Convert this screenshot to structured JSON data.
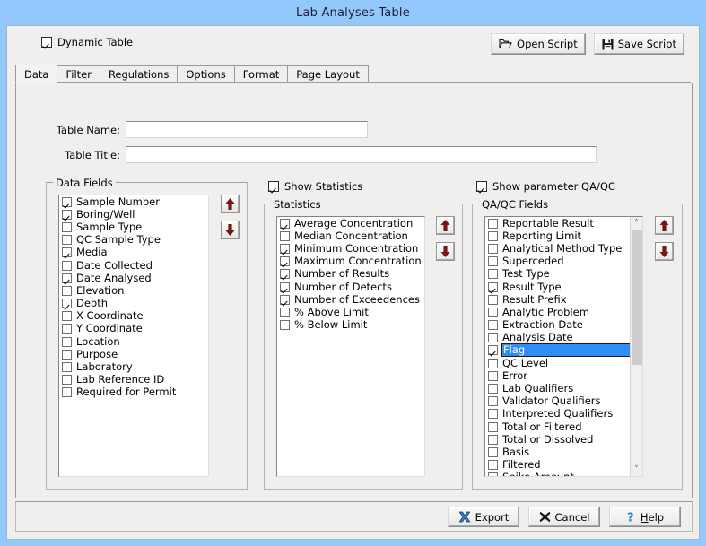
{
  "window": {
    "title": "Lab Analyses Table"
  },
  "toolbar": {
    "dynamic_table_label": "Dynamic Table",
    "dynamic_table_checked": true,
    "open_script_label": "Open Script",
    "save_script_label": "Save Script"
  },
  "tabs": [
    {
      "label": "Data",
      "active": true
    },
    {
      "label": "Filter",
      "active": false
    },
    {
      "label": "Regulations",
      "active": false
    },
    {
      "label": "Options",
      "active": false
    },
    {
      "label": "Format",
      "active": false
    },
    {
      "label": "Page Layout",
      "active": false
    }
  ],
  "form": {
    "table_name_label": "Table Name:",
    "table_name_value": "",
    "table_title_label": "Table Title:",
    "table_title_value": ""
  },
  "data_fields": {
    "group_label": "Data Fields",
    "items": [
      {
        "label": "Sample Number",
        "checked": true
      },
      {
        "label": "Boring/Well",
        "checked": true
      },
      {
        "label": "Sample Type",
        "checked": false
      },
      {
        "label": "QC Sample Type",
        "checked": false
      },
      {
        "label": "Media",
        "checked": true
      },
      {
        "label": "Date Collected",
        "checked": false
      },
      {
        "label": "Date Analysed",
        "checked": true
      },
      {
        "label": "Elevation",
        "checked": false
      },
      {
        "label": "Depth",
        "checked": true
      },
      {
        "label": "X Coordinate",
        "checked": false
      },
      {
        "label": "Y Coordinate",
        "checked": false
      },
      {
        "label": "Location",
        "checked": false
      },
      {
        "label": "Purpose",
        "checked": false
      },
      {
        "label": "Laboratory",
        "checked": false
      },
      {
        "label": "Lab Reference ID",
        "checked": false
      },
      {
        "label": "Required for Permit",
        "checked": false
      }
    ]
  },
  "statistics": {
    "show_label": "Show Statistics",
    "show_checked": true,
    "group_label": "Statistics",
    "items": [
      {
        "label": "Average Concentration",
        "checked": true
      },
      {
        "label": "Median Concentration",
        "checked": false
      },
      {
        "label": "Minimum Concentration",
        "checked": true
      },
      {
        "label": "Maximum Concentration",
        "checked": true
      },
      {
        "label": "Number of Results",
        "checked": true
      },
      {
        "label": "Number of Detects",
        "checked": true
      },
      {
        "label": "Number of Exceedences",
        "checked": true
      },
      {
        "label": "% Above Limit",
        "checked": false
      },
      {
        "label": "% Below Limit",
        "checked": false
      }
    ]
  },
  "qaqc": {
    "show_label": "Show parameter QA/QC",
    "show_checked": true,
    "group_label": "QA/QC Fields",
    "items": [
      {
        "label": "Reportable Result",
        "checked": false,
        "selected": false
      },
      {
        "label": "Reporting Limit",
        "checked": false,
        "selected": false
      },
      {
        "label": "Analytical Method Type",
        "checked": false,
        "selected": false
      },
      {
        "label": "Superceded",
        "checked": false,
        "selected": false
      },
      {
        "label": "Test Type",
        "checked": false,
        "selected": false
      },
      {
        "label": "Result Type",
        "checked": true,
        "selected": false
      },
      {
        "label": "Result Prefix",
        "checked": false,
        "selected": false
      },
      {
        "label": "Analytic Problem",
        "checked": false,
        "selected": false
      },
      {
        "label": "Extraction Date",
        "checked": false,
        "selected": false
      },
      {
        "label": "Analysis Date",
        "checked": false,
        "selected": false
      },
      {
        "label": "Flag",
        "checked": true,
        "selected": true
      },
      {
        "label": "QC Level",
        "checked": false,
        "selected": false
      },
      {
        "label": "Error",
        "checked": false,
        "selected": false
      },
      {
        "label": "Lab Qualifiers",
        "checked": false,
        "selected": false
      },
      {
        "label": "Validator Qualifiers",
        "checked": false,
        "selected": false
      },
      {
        "label": "Interpreted Qualifiers",
        "checked": false,
        "selected": false
      },
      {
        "label": "Total or Filtered",
        "checked": false,
        "selected": false
      },
      {
        "label": "Total or Dissolved",
        "checked": false,
        "selected": false
      },
      {
        "label": "Basis",
        "checked": false,
        "selected": false
      },
      {
        "label": "Filtered",
        "checked": false,
        "selected": false
      },
      {
        "label": "Spike Amount",
        "checked": false,
        "selected": false
      }
    ],
    "scroll_up_glyph": "˄",
    "scroll_down_glyph": "˅"
  },
  "reorder": {
    "up_glyph": "⬆",
    "down_glyph": "⬇"
  },
  "footer": {
    "export_label": "Export",
    "cancel_label": "Cancel",
    "help_label_prefix": "H",
    "help_label_rest": "elp"
  },
  "colors": {
    "titlebar": "#93c8fc",
    "dialog": "#f0efee",
    "selection": "#2f8ef4",
    "arrow": "#7b1515"
  }
}
